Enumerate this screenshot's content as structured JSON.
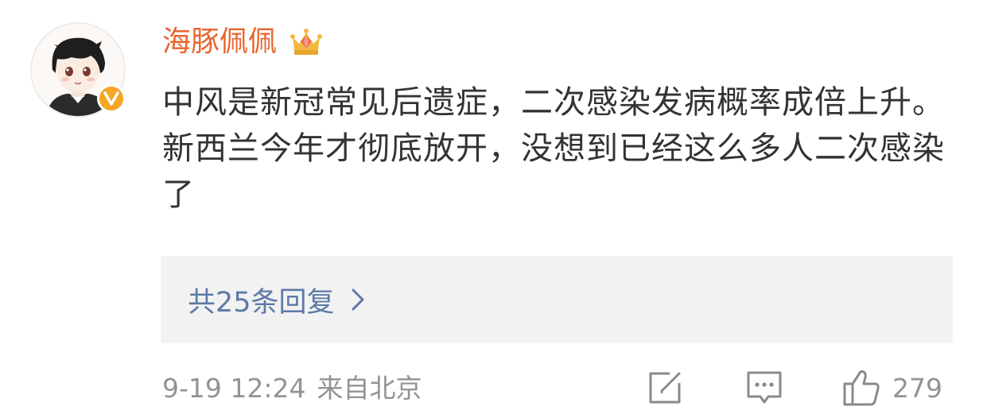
{
  "post_comment": {
    "author": {
      "name": "海豚佩佩",
      "avatar_icon": "cartoon-boy-avatar-icon",
      "verified_icon": "verified-v-badge-icon",
      "member_icon": "crown-gem-member-icon",
      "name_color": "#e8642c",
      "badge_color": "#f5a623"
    },
    "text": "中风是新冠常见后遗症，二次感染发病概率成倍上升。新西兰今年才彻底放开，没想到已经这么多人二次感染了",
    "replies": {
      "label": "共25条回复",
      "icon": "chevron-right-icon",
      "color": "#5d7aa6"
    },
    "footer": {
      "timestamp": "9-19 12:24",
      "source": "来自北京",
      "share_icon": "edit-share-icon",
      "comment_icon": "comment-bubble-icon",
      "like_icon": "thumbs-up-icon",
      "like_count": "279"
    }
  }
}
